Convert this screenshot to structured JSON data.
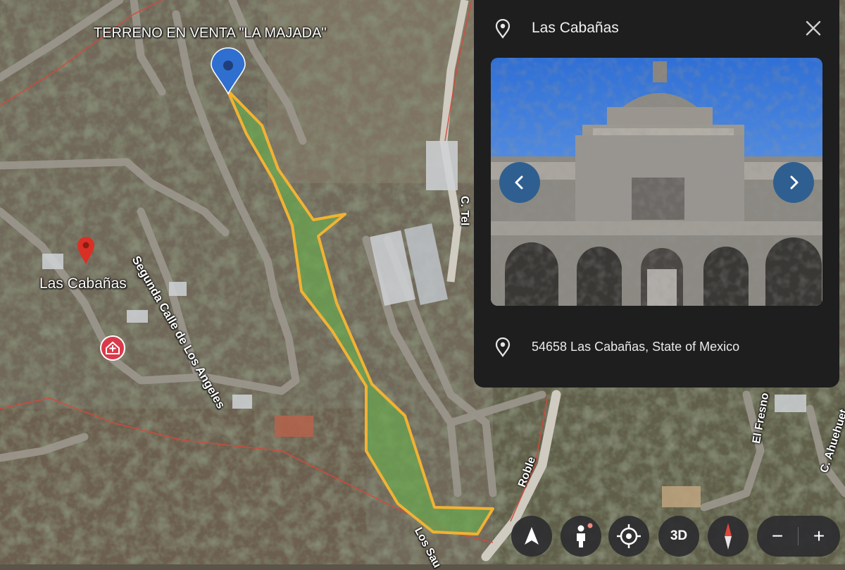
{
  "map": {
    "property_title": "TERRENO EN VENTA \"LA MAJADA\"",
    "place_label": "Las Cabañas",
    "streets": [
      {
        "name": "Segunda Calle de Los Angeles"
      },
      {
        "name": "C. Tel"
      },
      {
        "name": "Roble"
      },
      {
        "name": "Los Sau"
      },
      {
        "name": "El Fresno"
      },
      {
        "name": "C. Ahuehuet"
      }
    ],
    "marker_pin_icon": "location-pin-icon-blue",
    "place_pin_icon": "location-pin-icon-red",
    "hospital_icon": "hospital-icon",
    "colors": {
      "parcel_fill": "#6aa84f",
      "parcel_border": "#f2b233",
      "road_red": "#d24a3c",
      "marker_blue": "#2f6fcf",
      "pin_red": "#d93025"
    }
  },
  "panel": {
    "title": "Las Cabañas",
    "address": "54658 Las Cabañas, State of Mexico",
    "icons": {
      "title": "location-pin-icon",
      "close": "close-icon",
      "prev": "chevron-left-icon",
      "next": "chevron-right-icon",
      "address": "location-pin-icon"
    },
    "colors": {
      "background": "#1e1e1f",
      "nav_button": "#2f5f90"
    }
  },
  "controls": {
    "view_3d_label": "3D",
    "zoom_out_label": "−",
    "zoom_in_label": "+",
    "icons": [
      "navigation-arrow-icon",
      "pegman-icon",
      "my-location-icon",
      "compass-icon"
    ]
  }
}
